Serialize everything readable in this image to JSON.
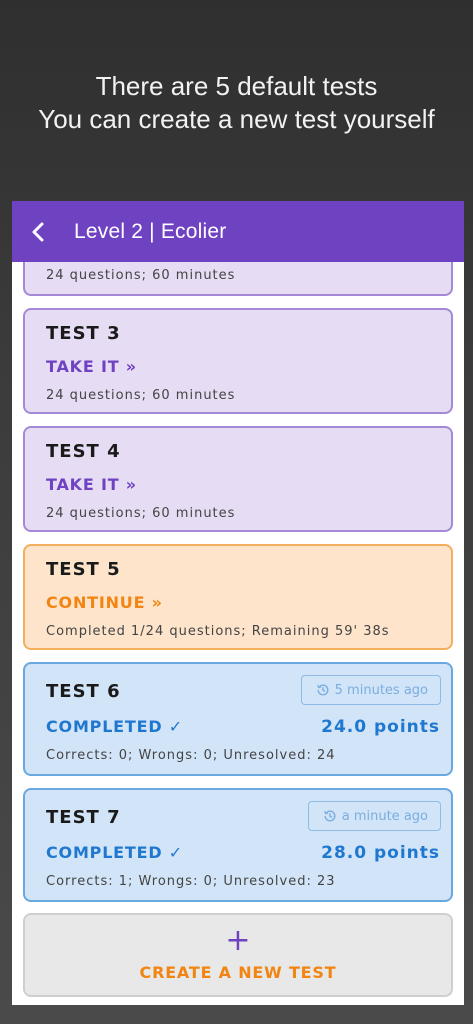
{
  "promo": {
    "line1": "There are 5 default tests",
    "line2": "You can create a new test yourself"
  },
  "appbar": {
    "back_icon": "chevron-left-icon",
    "title": "Level 2 | Ecolier"
  },
  "tests": [
    {
      "title": "",
      "action": "",
      "info": "24 questions; 60 minutes"
    },
    {
      "title": "TEST 3",
      "action": "TAKE IT »",
      "info": "24 questions; 60 minutes"
    },
    {
      "title": "TEST 4",
      "action": "TAKE IT »",
      "info": "24 questions; 60 minutes"
    },
    {
      "title": "TEST 5",
      "action": "CONTINUE »",
      "info": "Completed 1/24 questions; Remaining 59' 38s"
    },
    {
      "title": "TEST 6",
      "action": "COMPLETED ✓",
      "points": "24.0 points",
      "time": "5 minutes ago",
      "info": "Corrects: 0; Wrongs: 0; Unresolved: 24"
    },
    {
      "title": "TEST 7",
      "action": "COMPLETED ✓",
      "points": "28.0 points",
      "time": "a minute ago",
      "info": "Corrects: 1; Wrongs: 0; Unresolved: 23"
    }
  ],
  "create": {
    "icon": "plus-icon",
    "plus": "+",
    "label": "CREATE A NEW TEST"
  },
  "colors": {
    "accent": "#6f42c1",
    "orange": "#f28411",
    "blue": "#1f78cf"
  }
}
